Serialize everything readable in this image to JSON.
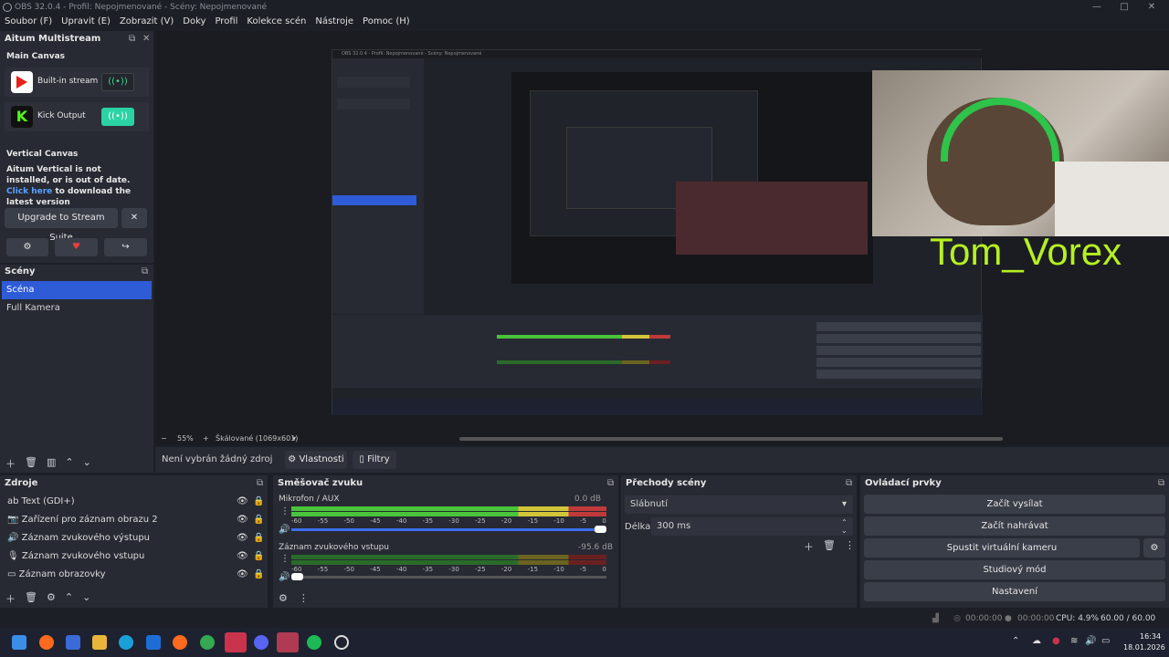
{
  "window": {
    "title": "OBS 32.0.4 - Profil: Nepojmenované - Scény: Nepojmenované"
  },
  "menu": [
    "Soubor (F)",
    "Upravit (E)",
    "Zobrazit (V)",
    "Doky",
    "Profil",
    "Kolekce scén",
    "Nástroje",
    "Pomoc (H)"
  ],
  "multistream": {
    "title": "Aitum Multistream",
    "main_canvas": "Main Canvas",
    "outputs": [
      {
        "name": "Built-in stream",
        "icon": "youtube-icon",
        "color": "#e62117"
      },
      {
        "name": "Kick Output",
        "icon": "kick-icon",
        "color": "#53fc18"
      }
    ],
    "vertical_canvas": "Vertical Canvas",
    "vertical_msg": "Aitum Vertical is not installed, or is out of date.",
    "click_here": "Click here",
    "download_msg": "to download the latest version",
    "upgrade_btn": "Upgrade to Stream Suite"
  },
  "scenes": {
    "title": "Scény",
    "items": [
      "Scéna",
      "Full Kamera"
    ],
    "active_index": 0
  },
  "preview": {
    "zoom": "55%",
    "scale": "Škálované (1069x601)",
    "overlay_name": "Tom_Vorex",
    "nested_title": "OBS 32.0.4 - Profil: Nepojmenované - Scény: Nepojmenované"
  },
  "context_bar": {
    "no_source": "Není vybrán žádný zdroj",
    "properties": "Vlastnosti",
    "filters": "Filtry"
  },
  "sources": {
    "title": "Zdroje",
    "items": [
      "Text (GDI+)",
      "Zařízení pro záznam obrazu 2",
      "Záznam zvukového výstupu",
      "Záznam zvukového vstupu",
      "Záznam obrazovky"
    ]
  },
  "mixer": {
    "title": "Směšovač zvuku",
    "channels": [
      {
        "name": "Mikrofon / AUX",
        "db": "0.0 dB",
        "level": 1.0
      },
      {
        "name": "Záznam zvukového vstupu",
        "db": "-95.6 dB",
        "level": 0.08
      }
    ],
    "ticks": [
      "-60",
      "-55",
      "-50",
      "-45",
      "-40",
      "-35",
      "-30",
      "-25",
      "-20",
      "-15",
      "-10",
      "-5",
      "0"
    ]
  },
  "transitions": {
    "title": "Přechody scény",
    "selected": "Slábnutí",
    "duration_label": "Délka",
    "duration_value": "300 ms"
  },
  "controls": {
    "title": "Ovládací prvky",
    "buttons": [
      "Začít vysílat",
      "Začít nahrávat",
      "Spustit virtuální kameru",
      "Studiový mód",
      "Nastavení"
    ]
  },
  "status": {
    "stream_time": "00:00:00",
    "rec_time": "00:00:00",
    "cpu": "CPU: 4.9%",
    "fps": "60.00 / 60.00 FPS"
  },
  "taskbar": {
    "time": "16:34",
    "date": "18.01.2026"
  }
}
